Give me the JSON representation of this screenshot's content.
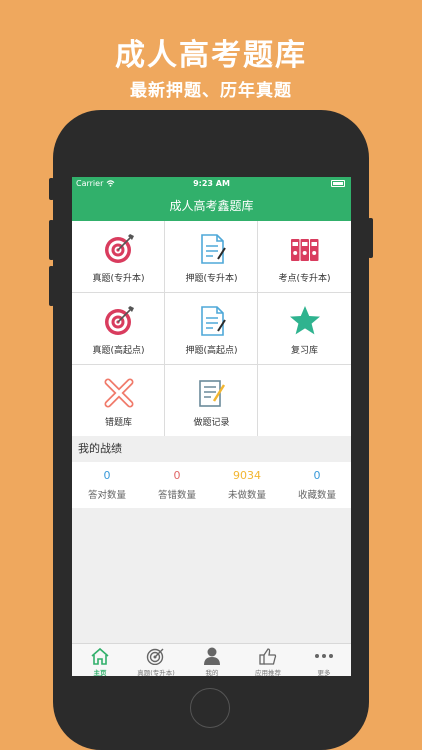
{
  "promo": {
    "title": "成人高考题库",
    "subtitle": "最新押题、历年真题"
  },
  "status_bar": {
    "carrier": "Carrier",
    "time": "9:23 AM"
  },
  "nav": {
    "title": "成人高考鑫题库"
  },
  "grid": {
    "items": [
      {
        "label": "真题(专升本)",
        "icon": "target-icon"
      },
      {
        "label": "押题(专升本)",
        "icon": "document-pen-icon"
      },
      {
        "label": "考点(专升本)",
        "icon": "binders-icon"
      },
      {
        "label": "真题(高起点)",
        "icon": "target-icon"
      },
      {
        "label": "押题(高起点)",
        "icon": "document-pen-icon"
      },
      {
        "label": "复习库",
        "icon": "star-icon"
      },
      {
        "label": "错题库",
        "icon": "cross-icon"
      },
      {
        "label": "做题记录",
        "icon": "record-icon"
      }
    ]
  },
  "stats": {
    "header": "我的战绩",
    "items": [
      {
        "value": "0",
        "label": "答对数量",
        "color": "#3A9AD9"
      },
      {
        "value": "0",
        "label": "答错数量",
        "color": "#E06666"
      },
      {
        "value": "9034",
        "label": "未做数量",
        "color": "#F2B632"
      },
      {
        "value": "0",
        "label": "收藏数量",
        "color": "#3A9AD9"
      }
    ]
  },
  "tabs": [
    {
      "label": "主页",
      "active": true
    },
    {
      "label": "真题(专升本)",
      "active": false
    },
    {
      "label": "我的",
      "active": false
    },
    {
      "label": "应用推荐",
      "active": false
    },
    {
      "label": "更多",
      "active": false
    }
  ],
  "colors": {
    "accent": "#31B06B",
    "background": "#EFA85E",
    "target": "#D93C5E",
    "doc": "#4FA8D8",
    "star": "#2FB38F"
  }
}
